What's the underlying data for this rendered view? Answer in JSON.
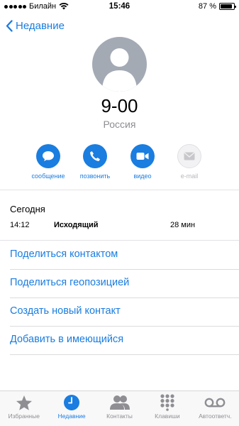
{
  "status": {
    "carrier": "Билайн",
    "time": "15:46",
    "battery": "87 %",
    "battery_level": 0.87
  },
  "nav": {
    "back_label": "Недавние"
  },
  "contact": {
    "name": "9-00",
    "subtitle": "Россия"
  },
  "actions": [
    {
      "label": "сообщение",
      "icon": "message-icon",
      "enabled": true
    },
    {
      "label": "позвонить",
      "icon": "phone-icon",
      "enabled": true
    },
    {
      "label": "видео",
      "icon": "video-icon",
      "enabled": true
    },
    {
      "label": "e-mail",
      "icon": "mail-icon",
      "enabled": false
    }
  ],
  "recent": {
    "title": "Сегодня",
    "calls": [
      {
        "time": "14:12",
        "type": "Исходящий",
        "duration": "28 мин"
      }
    ]
  },
  "links": [
    "Поделиться контактом",
    "Поделиться геопозицией",
    "Создать новый контакт",
    "Добавить в имеющийся"
  ],
  "tabs": [
    {
      "label": "Избранные",
      "icon": "star-icon",
      "active": false
    },
    {
      "label": "Недавние",
      "icon": "clock-icon",
      "active": true
    },
    {
      "label": "Контакты",
      "icon": "contacts-icon",
      "active": false
    },
    {
      "label": "Клавиши",
      "icon": "keypad-icon",
      "active": false
    },
    {
      "label": "Автоответч.",
      "icon": "voicemail-icon",
      "active": false
    }
  ],
  "colors": {
    "accent": "#1a7de0",
    "muted": "#8e8e93",
    "avatar_bg": "#a3aab4"
  }
}
